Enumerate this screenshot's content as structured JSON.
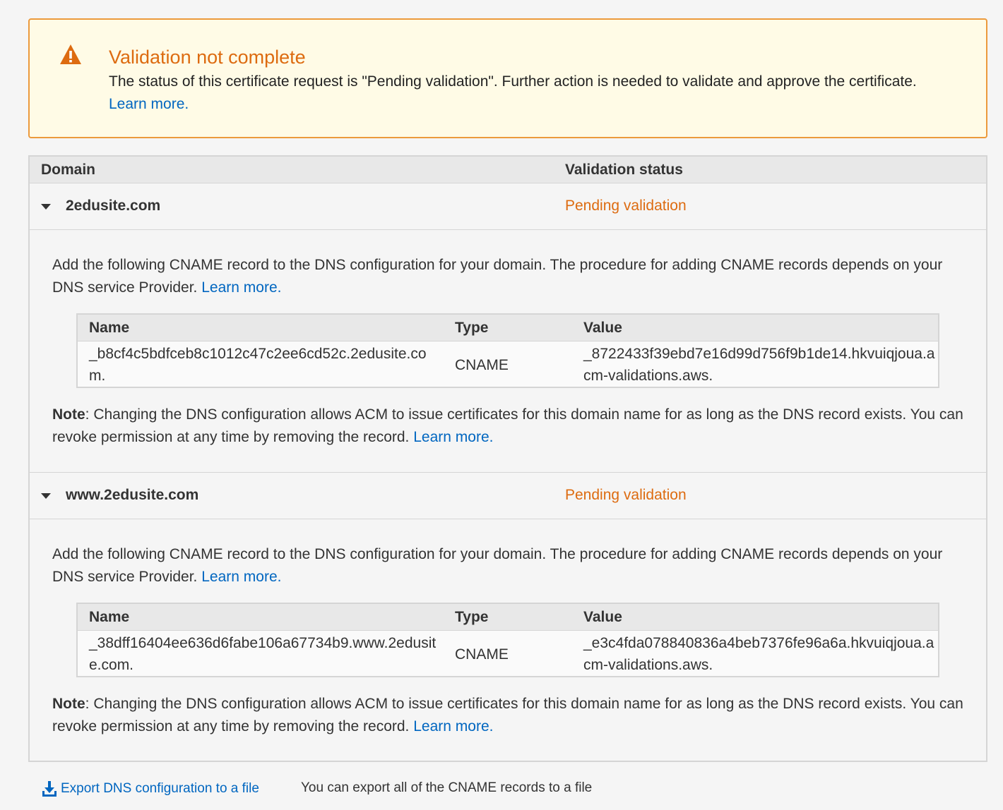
{
  "alert": {
    "icon": "warning-icon",
    "title": "Validation not complete",
    "message": "The status of this certificate request is \"Pending validation\". Further action is needed to validate and approve the certificate.",
    "learn_more": "Learn more."
  },
  "table": {
    "headers": {
      "domain": "Domain",
      "status": "Validation status"
    },
    "domains": [
      {
        "name": "2edusite.com",
        "status": "Pending validation",
        "intro": "Add the following CNAME record to the DNS configuration for your domain. The procedure for adding CNAME records depends on your DNS service Provider.",
        "intro_link": "Learn more.",
        "record": {
          "headers": {
            "name": "Name",
            "type": "Type",
            "value": "Value"
          },
          "name": "_b8cf4c5bdfceb8c1012c47c2ee6cd52c.2edusite.com.",
          "type": "CNAME",
          "value": "_8722433f39ebd7e16d99d756f9b1de14.hkvuiqjoua.acm-validations.aws."
        },
        "note_label": "Note",
        "note": ": Changing the DNS configuration allows ACM to issue certificates for this domain name for as long as the DNS record exists. You can revoke permission at any time by removing the record.",
        "note_link": "Learn more."
      },
      {
        "name": "www.2edusite.com",
        "status": "Pending validation",
        "intro": "Add the following CNAME record to the DNS configuration for your domain. The procedure for adding CNAME records depends on your DNS service Provider.",
        "intro_link": "Learn more.",
        "record": {
          "headers": {
            "name": "Name",
            "type": "Type",
            "value": "Value"
          },
          "name": "_38dff16404ee636d6fabe106a67734b9.www.2edusite.com.",
          "type": "CNAME",
          "value": "_e3c4fda078840836a4beb7376fe96a6a.hkvuiqjoua.acm-validations.aws."
        },
        "note_label": "Note",
        "note": ": Changing the DNS configuration allows ACM to issue certificates for this domain name for as long as the DNS record exists. You can revoke permission at any time by removing the record.",
        "note_link": "Learn more."
      }
    ]
  },
  "export": {
    "icon": "download-icon",
    "label": "Export DNS configuration to a file",
    "description": "You can export all of the CNAME records to a file"
  },
  "colors": {
    "warning": "#dd6b10",
    "alert_border": "#ec9a3c",
    "alert_bg": "#fffbe6",
    "link": "#0066c0"
  }
}
